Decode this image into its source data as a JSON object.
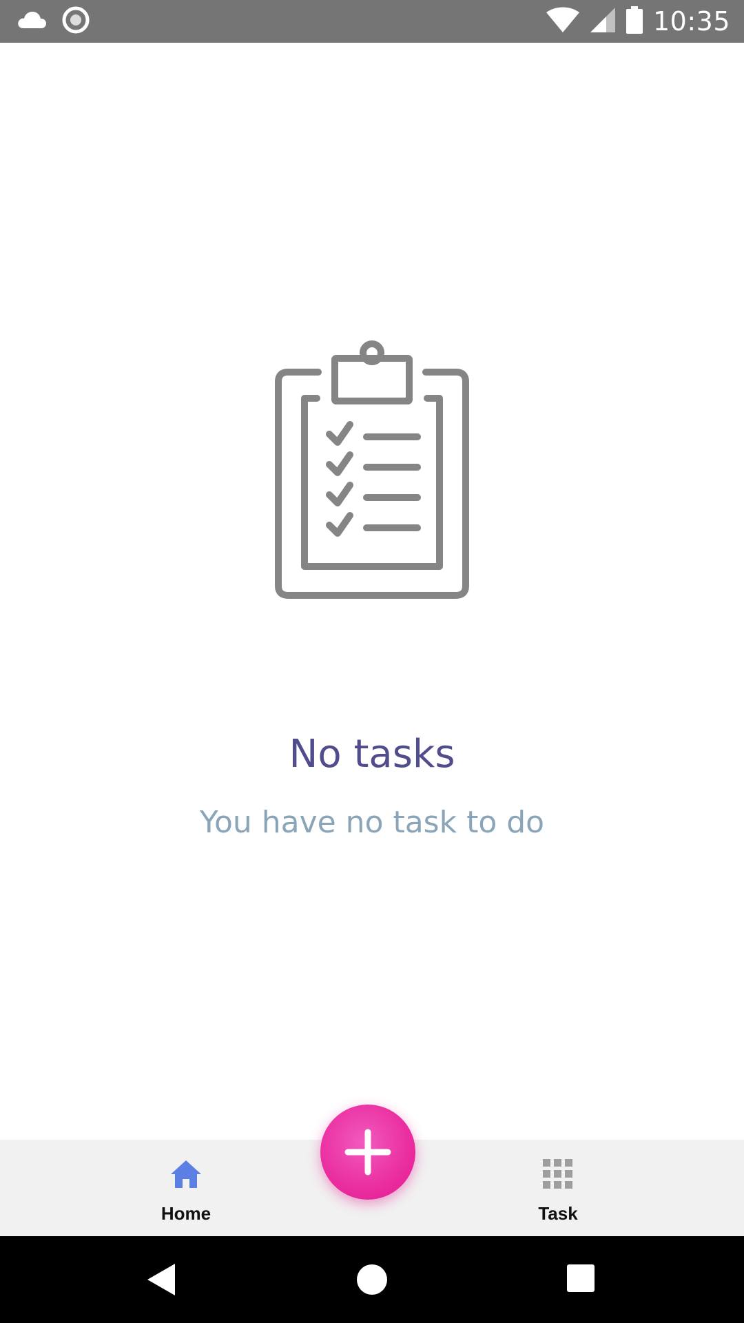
{
  "status_bar": {
    "time": "10:35",
    "icons": [
      "cloud-icon",
      "record-icon",
      "wifi-icon",
      "signal-icon",
      "battery-icon"
    ]
  },
  "empty_state": {
    "icon": "clipboard-checklist-icon",
    "title": "No tasks",
    "subtitle": "You have no task to do"
  },
  "bottom_nav": {
    "items": [
      {
        "label": "Home",
        "icon": "home-icon",
        "active": true
      },
      {
        "label": "Task",
        "icon": "grid-icon",
        "active": false
      }
    ],
    "fab_icon": "plus-icon"
  },
  "system_nav": {
    "buttons": [
      "back-icon",
      "home-circle-icon",
      "recents-icon"
    ]
  },
  "colors": {
    "status_bar": "#757575",
    "title": "#514c8c",
    "subtitle": "#8aa4b8",
    "nav_active": "#5b7fe3",
    "nav_inactive": "#9e9e9e",
    "fab": "#ea2e9f",
    "nav_background": "#f1f1f1"
  }
}
